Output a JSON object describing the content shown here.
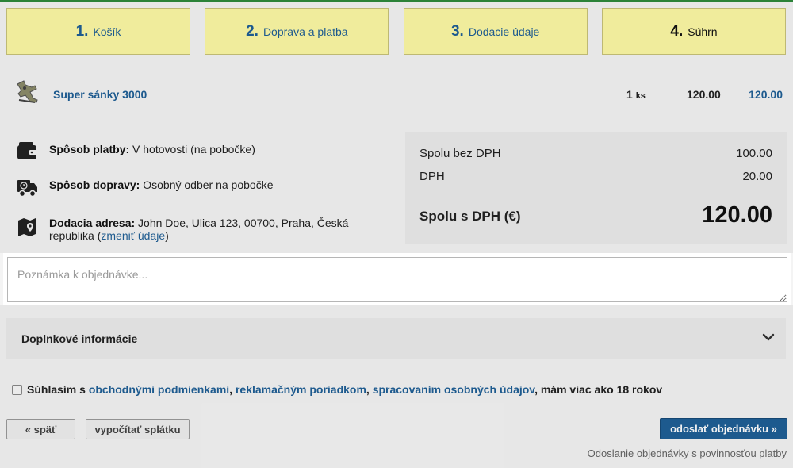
{
  "steps": [
    {
      "num": "1.",
      "label": "Košík"
    },
    {
      "num": "2.",
      "label": "Doprava a platba"
    },
    {
      "num": "3.",
      "label": "Dodacie údaje"
    },
    {
      "num": "4.",
      "label": "Súhrn"
    }
  ],
  "product": {
    "name": "Super sánky 3000",
    "qty": "1",
    "qty_unit": "ks",
    "unit_price": "120.00",
    "total": "120.00"
  },
  "info": {
    "payment_label": "Spôsob platby:",
    "payment_value": " V hotovosti (na pobočke)",
    "delivery_label": "Spôsob dopravy:",
    "delivery_value": " Osobný odber na pobočke",
    "address_label": "Dodacia adresa:",
    "address_value": " John Doe, Ulica 123, 00700, Praha, Česká republika (",
    "change_link": "zmeniť údaje",
    "address_close": ")"
  },
  "summary": {
    "without_vat_label": "Spolu bez DPH",
    "without_vat_value": "100.00",
    "vat_label": "DPH",
    "vat_value": "20.00",
    "total_label": "Spolu s DPH (€)",
    "total_value": "120.00"
  },
  "note": {
    "placeholder": "Poznámka k objednávke...",
    "value": ""
  },
  "extra_info": {
    "label": "Doplnkové informácie"
  },
  "agreement": {
    "prefix": "Súhlasím s ",
    "link_terms": "obchodnými podmienkami",
    "sep1": ", ",
    "link_complaints": "reklamačným poriadkom",
    "sep2": ", ",
    "link_privacy": "spracovaním osobných údajov",
    "suffix": ", mám viac ako 18 rokov"
  },
  "buttons": {
    "back": "« späť",
    "calc": "vypočítať splátku",
    "submit": "odoslať objednávku »"
  },
  "footnote": "Odoslanie objednávky s povinnosťou platby",
  "colors": {
    "accent": "#1f5f96",
    "step_bg": "#fdf9a5",
    "topline": "#2e8a3c"
  },
  "icons": {
    "product": "sled-icon",
    "payment": "wallet-icon",
    "delivery": "truck-icon",
    "address": "map-pin-icon",
    "accordion": "chevron-down-icon"
  }
}
